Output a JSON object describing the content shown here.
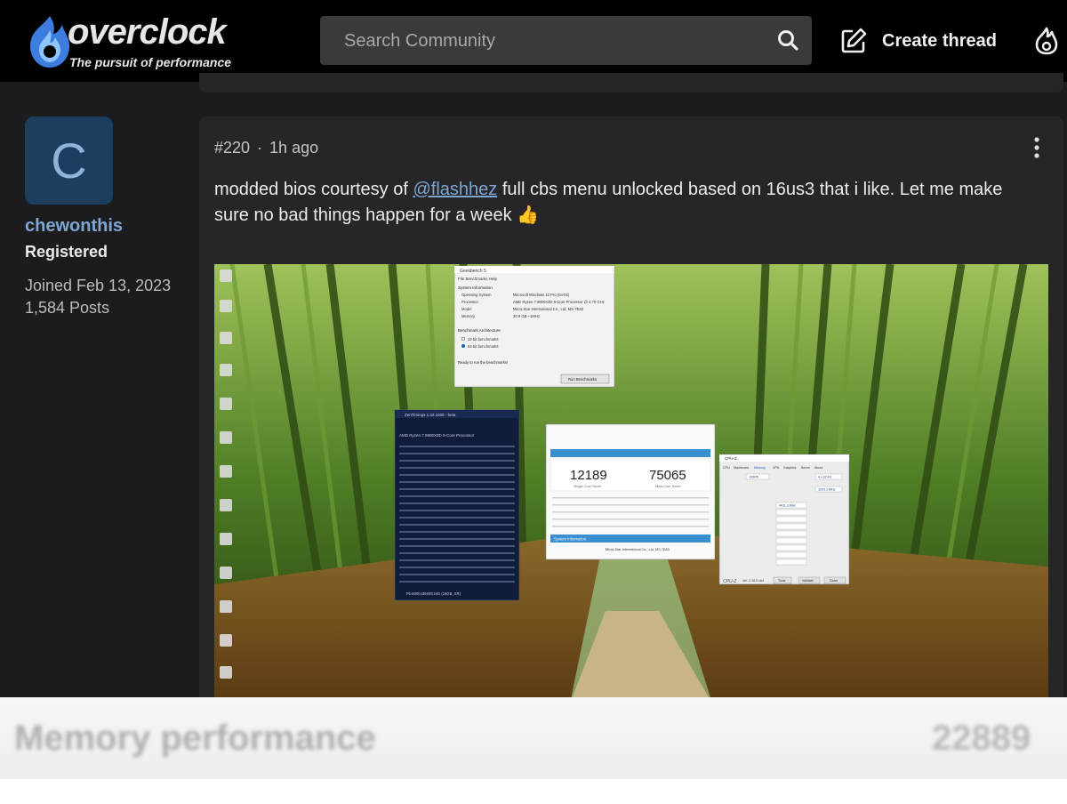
{
  "header": {
    "logo_word": "overclock",
    "logo_tagline": "The pursuit of performance",
    "search_placeholder": "Search Community",
    "create_label": "Create thread"
  },
  "author": {
    "avatar_letter": "C",
    "username": "chewonthis",
    "role": "Registered",
    "joined": "Joined Feb 13, 2023",
    "posts": "1,584 Posts"
  },
  "post": {
    "number": "#220",
    "separator": "·",
    "time": "1h ago",
    "text_before": "modded bios courtesy of ",
    "mention": "@flashhez",
    "text_after": " full cbs menu unlocked based on 16us3 that i like. Let me make sure no bad things happen for a week 👍"
  },
  "screenshot": {
    "geekbench_title": "Geekbench 5",
    "geekbench_menu": "File   Benchmarks   Help",
    "sysinfo_heading": "System Information",
    "os_label": "Operating System",
    "os_value": "Microsoft Windows 10 Pro (64-bit)",
    "processor_label": "Processor",
    "processor_value": "AMD Ryzen 7 9800X3D 8-Core Processor @ 4.70 GHz",
    "model_label": "Model",
    "model_value": "Micro-Star International Co., Ltd. MS-7E83",
    "memory_label": "Memory",
    "memory_value": "30.9 GB ~1MHz",
    "arch_heading": "Benchmark Architecture",
    "arch_32": "32-bit benchmarks",
    "arch_64": "64-bit benchmarks",
    "ready_text": "Ready to run the benchmarks!",
    "run_button": "Run Benchmarks",
    "single_score": "12189",
    "single_label": "Single-Core Score",
    "multi_score": "75065",
    "multi_label": "Multi-Core Score",
    "system_info_bar": "System Information",
    "board_text": "Micro-Star International Co., Ltd. MS-7E83",
    "cpuz_title": "CPU-Z",
    "cpuz_tabs": [
      "CPU",
      "Mainboard",
      "Memory",
      "SPD",
      "Graphics",
      "Bench",
      "About"
    ],
    "cpuz_type": "DDR5",
    "cpuz_channels": "4 x 32-bit",
    "cpuz_freq": "3203.1 MHz",
    "cpuz_dram": "4411.3 MHz",
    "cpuz_ver": "Ver. 2.16.0.x64",
    "cpuz_tools": "Tools",
    "cpuz_validate": "Validate",
    "cpuz_close": "Close",
    "zentimings_title": "ZenTimings 1.32.1606 - beta",
    "zentimings_cpu": "AMD Ryzen 7 9800X3D 8-Core Processor",
    "zentimings_footer": "F5-6000J3040G16G (16GB, SR)"
  },
  "overlay": {
    "label": "Memory performance",
    "value": "22889"
  },
  "colors": {
    "page_bg": "#1c1c1e",
    "card_bg": "#262628",
    "accent": "#7ea6d4",
    "avatar_bg": "#1e3e5f",
    "geekbench_blue": "#3a8fd1"
  }
}
